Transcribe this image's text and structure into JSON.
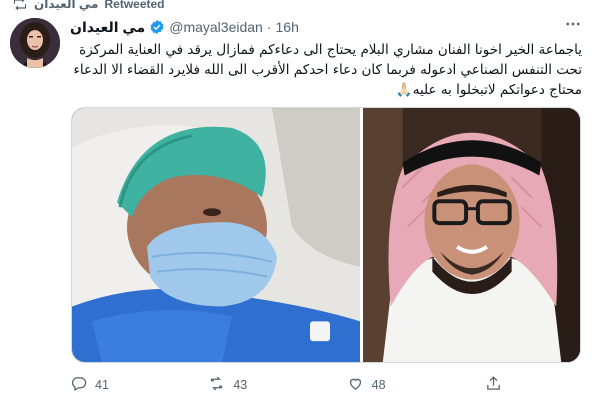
{
  "context": {
    "retweeter_name": "مي العيدان",
    "retweeted_label": "Retweeted"
  },
  "tweet": {
    "display_name": "مي العيدان",
    "handle": "@mayal3eidan",
    "separator": "·",
    "time": "16h",
    "text": "ياجماعة الخير اخونا الفنان مشاري البلام يحتاج الى دعاءكم فمازال يرقد في العناية المركزة تحت التنفس الصناعي ادعوله فربما كان دعاء احدكم الأقرب الى الله فلايرد القضاء الا الدعاء محتاج دعواتكم لاتبخلوا به عليه🙏🏻"
  },
  "media": {
    "left_photo": "hospital-patient-photo",
    "right_photo": "portrait-photo"
  },
  "actions": {
    "reply_count": "41",
    "retweet_count": "43",
    "like_count": "48",
    "share_label": ""
  },
  "icons": {
    "retweet": "retweet-icon",
    "verified": "verified-badge-icon",
    "more": "more-options-icon",
    "reply": "reply-icon",
    "like": "heart-icon",
    "share": "share-icon"
  },
  "colors": {
    "verified": "#1d9bf0",
    "secondary_text": "#536471",
    "primary_text": "#0f1419"
  }
}
